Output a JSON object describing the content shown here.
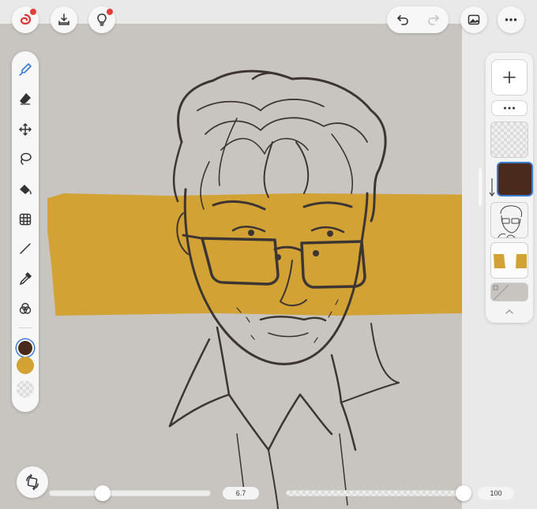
{
  "top_bar": {
    "left_buttons": [
      {
        "icon": "app-logo-icon",
        "notification": true
      },
      {
        "icon": "import-tray-icon",
        "notification": false
      },
      {
        "icon": "lightbulb-icon",
        "notification": true
      }
    ],
    "history": {
      "undo_icon": "undo-icon",
      "redo_icon": "redo-icon",
      "redo_enabled": false
    },
    "right_buttons": [
      {
        "icon": "gallery-icon"
      },
      {
        "icon": "more-horizontal-icon"
      }
    ]
  },
  "tools": [
    {
      "name": "brush",
      "icon": "brush-pen-icon",
      "active": true
    },
    {
      "name": "eraser",
      "icon": "eraser-icon"
    },
    {
      "name": "move",
      "icon": "move-arrows-icon"
    },
    {
      "name": "lasso",
      "icon": "lasso-icon"
    },
    {
      "name": "fill",
      "icon": "paint-bucket-icon"
    },
    {
      "name": "transform",
      "icon": "grid-transform-icon"
    },
    {
      "name": "line",
      "icon": "line-icon"
    },
    {
      "name": "eyedropper",
      "icon": "eyedropper-icon"
    },
    {
      "name": "blend",
      "icon": "blend-circles-icon"
    }
  ],
  "colors": {
    "primary": "#4a2a1c",
    "secondary": "#d2a235",
    "canvas": "#c8c4c0",
    "accent": "#3a7bd5"
  },
  "layers": {
    "add_icon": "plus-icon",
    "options_icon": "more-horizontal-icon",
    "items": [
      {
        "type": "empty"
      },
      {
        "type": "color-fill",
        "color": "#4a2a1c",
        "selected": true
      },
      {
        "type": "sketch"
      },
      {
        "type": "ochre-shapes"
      },
      {
        "type": "background"
      }
    ],
    "collapse_icon": "chevron-up-icon"
  },
  "bottom": {
    "quick_toggle_icon": "canvas-rotate-icon",
    "brush_size": {
      "value": "6.7",
      "fraction": 0.33
    },
    "opacity": {
      "value": "100",
      "fraction": 1.0
    }
  }
}
